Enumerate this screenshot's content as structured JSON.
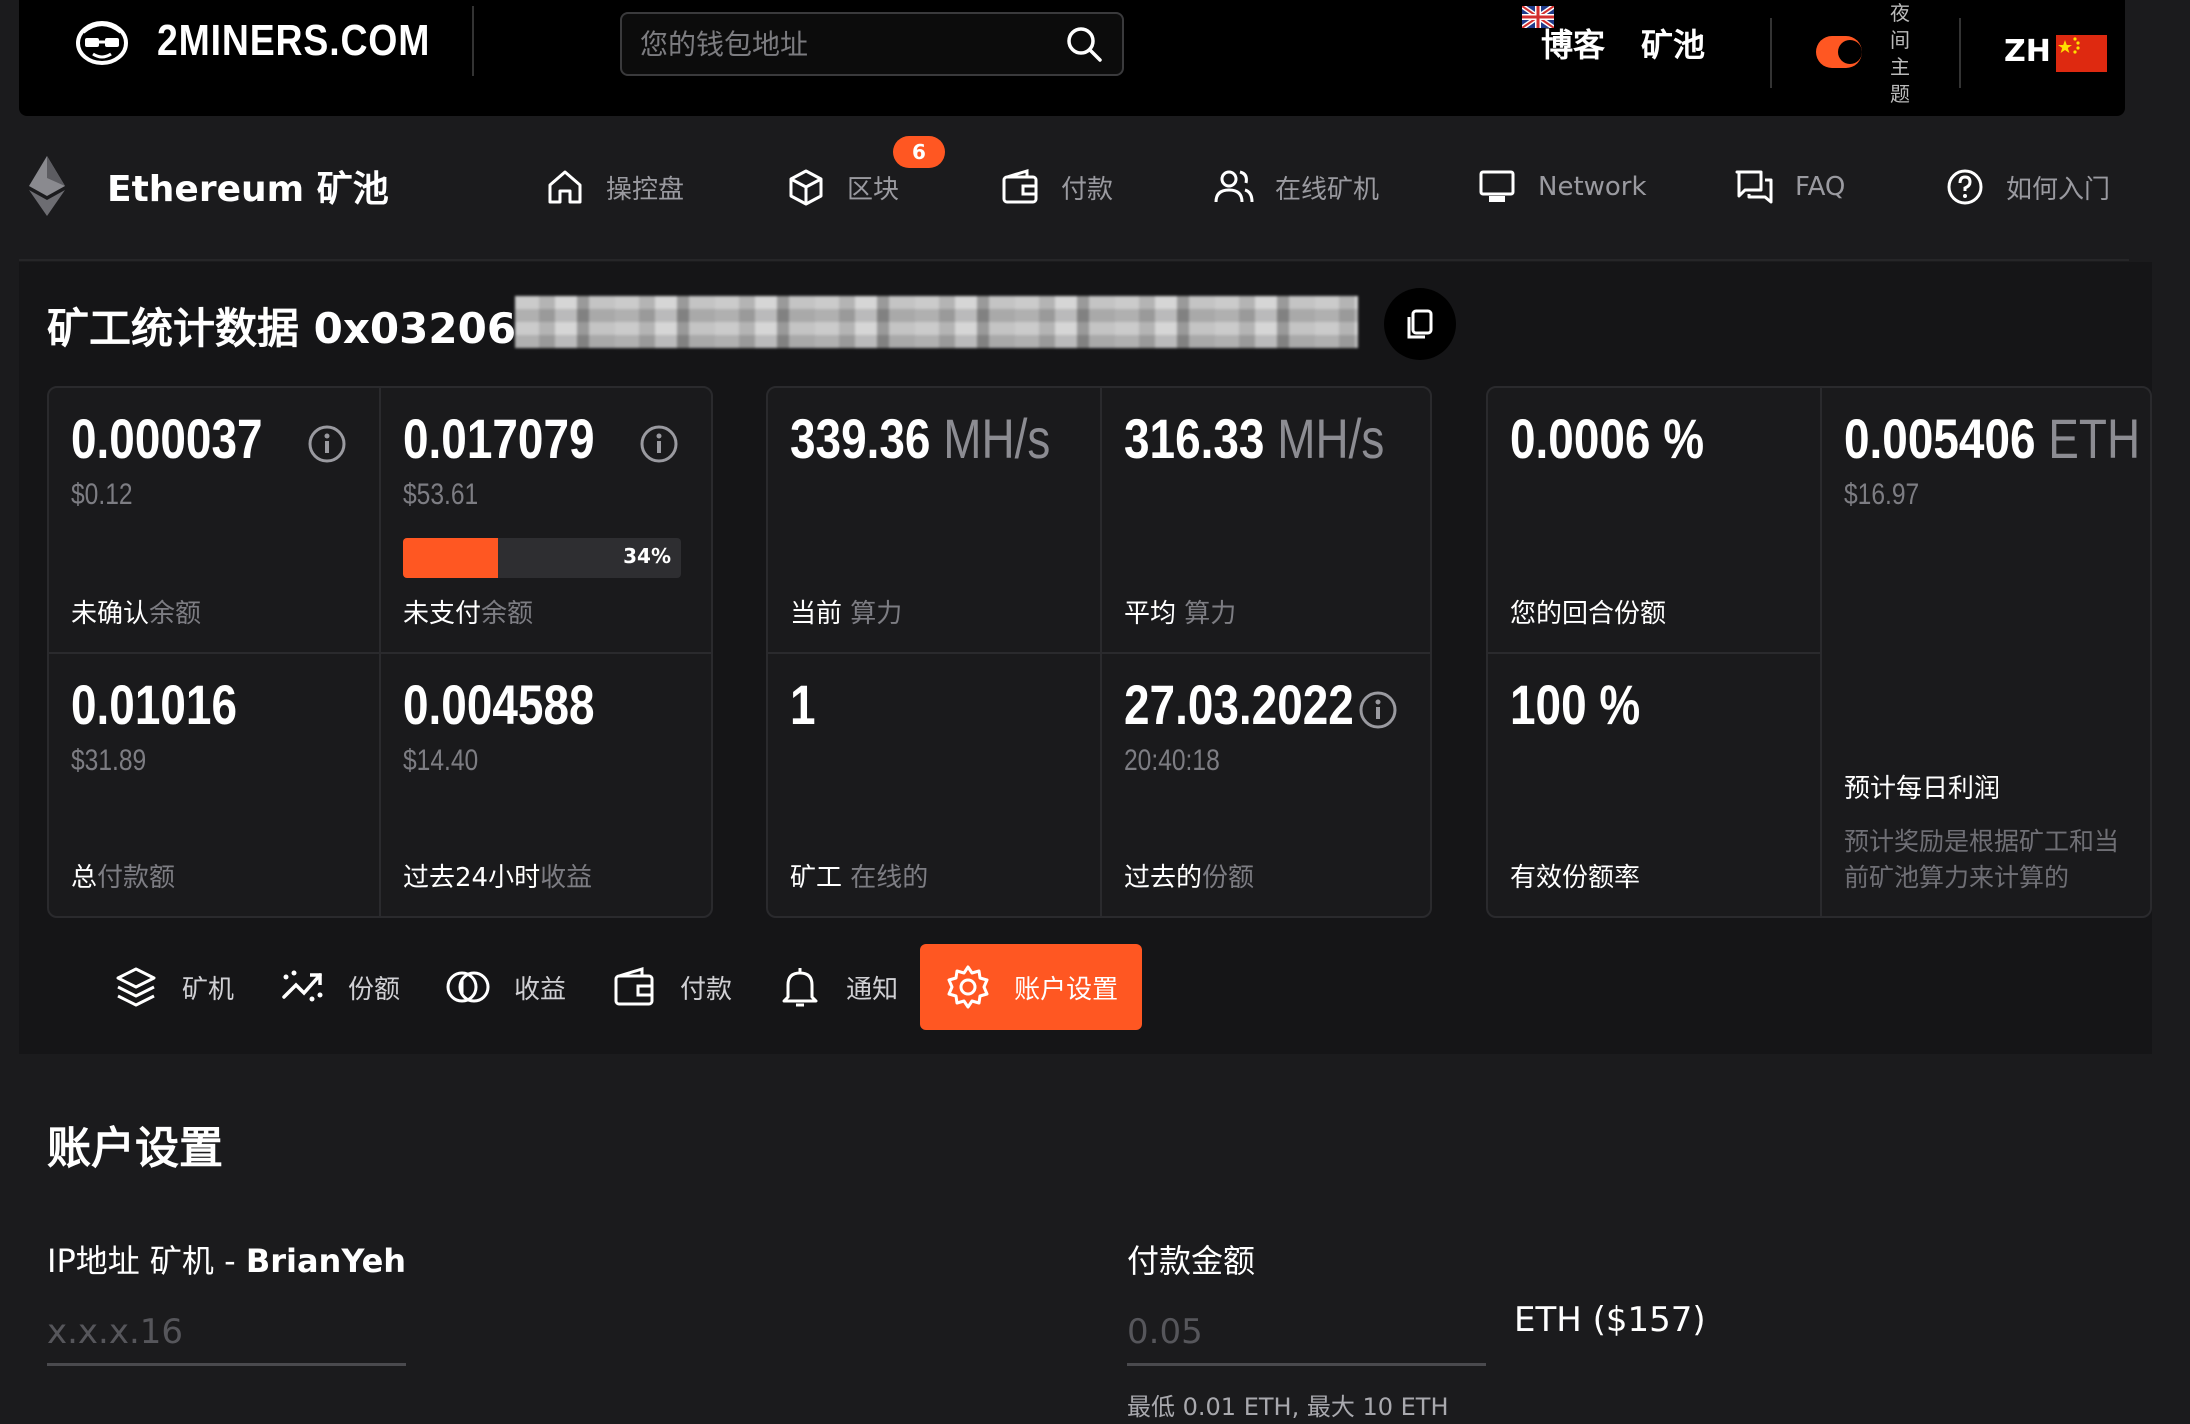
{
  "header": {
    "logo_text": "2MINERS.COM",
    "search_placeholder": "您的钱包地址",
    "blog_label": "博客",
    "pools_label": "矿池",
    "theme_label": "夜间主题",
    "lang_code": "ZH"
  },
  "pool_nav": {
    "pool_name": "Ethereum 矿池",
    "items": [
      {
        "label": "操控盘",
        "icon": "home-icon"
      },
      {
        "label": "区块",
        "icon": "cube-icon",
        "badge": "6"
      },
      {
        "label": "付款",
        "icon": "wallet-icon"
      },
      {
        "label": "在线矿机",
        "icon": "users-icon"
      },
      {
        "label": "Network",
        "icon": "monitor-icon"
      },
      {
        "label": "FAQ",
        "icon": "chat-icon"
      },
      {
        "label": "如何入门",
        "icon": "help-icon"
      }
    ]
  },
  "miner": {
    "title_prefix": "矿工统计数据 0x03206"
  },
  "stats": {
    "unconfirmed": {
      "value": "0.000037",
      "usd": "$0.12",
      "label_main": "未确认",
      "label_dim": "余额"
    },
    "unpaid": {
      "value": "0.017079",
      "usd": "$53.61",
      "progress_pct": 34,
      "progress_text": "34%",
      "label_main": "未支付",
      "label_dim": "余额"
    },
    "total_paid": {
      "value": "0.01016",
      "usd": "$31.89",
      "label_main": "总",
      "label_dim": "付款额"
    },
    "last24": {
      "value": "0.004588",
      "usd": "$14.40",
      "label_main": "过去24小时",
      "label_dim": "收益"
    },
    "current_hash": {
      "value": "339.36",
      "unit": "MH/s",
      "label_main": "当前 ",
      "label_dim": "算力"
    },
    "avg_hash": {
      "value": "316.33",
      "unit": "MH/s",
      "label_main": "平均 ",
      "label_dim": "算力"
    },
    "workers": {
      "value": "1",
      "label_main": "矿工 ",
      "label_dim": "在线的"
    },
    "last_share": {
      "value": "27.03.2022",
      "time": "20:40:18",
      "label_main": "过去的",
      "label_dim": "份额"
    },
    "round_share": {
      "value": "0.0006 %",
      "label": "您的回合份额"
    },
    "valid_rate": {
      "value": "100 %",
      "label": "有效份额率"
    },
    "daily_profit": {
      "value": "0.005406",
      "unit": "ETH",
      "usd": "$16.97",
      "label": "预计每日利润",
      "desc": "预计奖励是根据矿工和当前矿池算力来计算的"
    }
  },
  "tabs": [
    {
      "label": "矿机",
      "icon": "layers-icon"
    },
    {
      "label": "份额",
      "icon": "trend-icon"
    },
    {
      "label": "收益",
      "icon": "coins-icon"
    },
    {
      "label": "付款",
      "icon": "wallet-icon"
    },
    {
      "label": "通知",
      "icon": "bell-icon"
    },
    {
      "label": "账户设置",
      "icon": "gear-icon",
      "active": true
    }
  ],
  "settings": {
    "title": "账户设置",
    "ip_label_prefix": "IP地址 矿机 - ",
    "ip_label_worker": "BrianYeh",
    "ip_placeholder": "x.x.x.16",
    "payout_label": "付款金额",
    "payout_placeholder": "0.05",
    "payout_suffix": "ETH  ($157)",
    "payout_hint": "最低 0.01 ETH, 最大 10 ETH"
  },
  "colors": {
    "accent": "#ff5722",
    "background": "#1b1b1d",
    "topbar": "#000000"
  }
}
